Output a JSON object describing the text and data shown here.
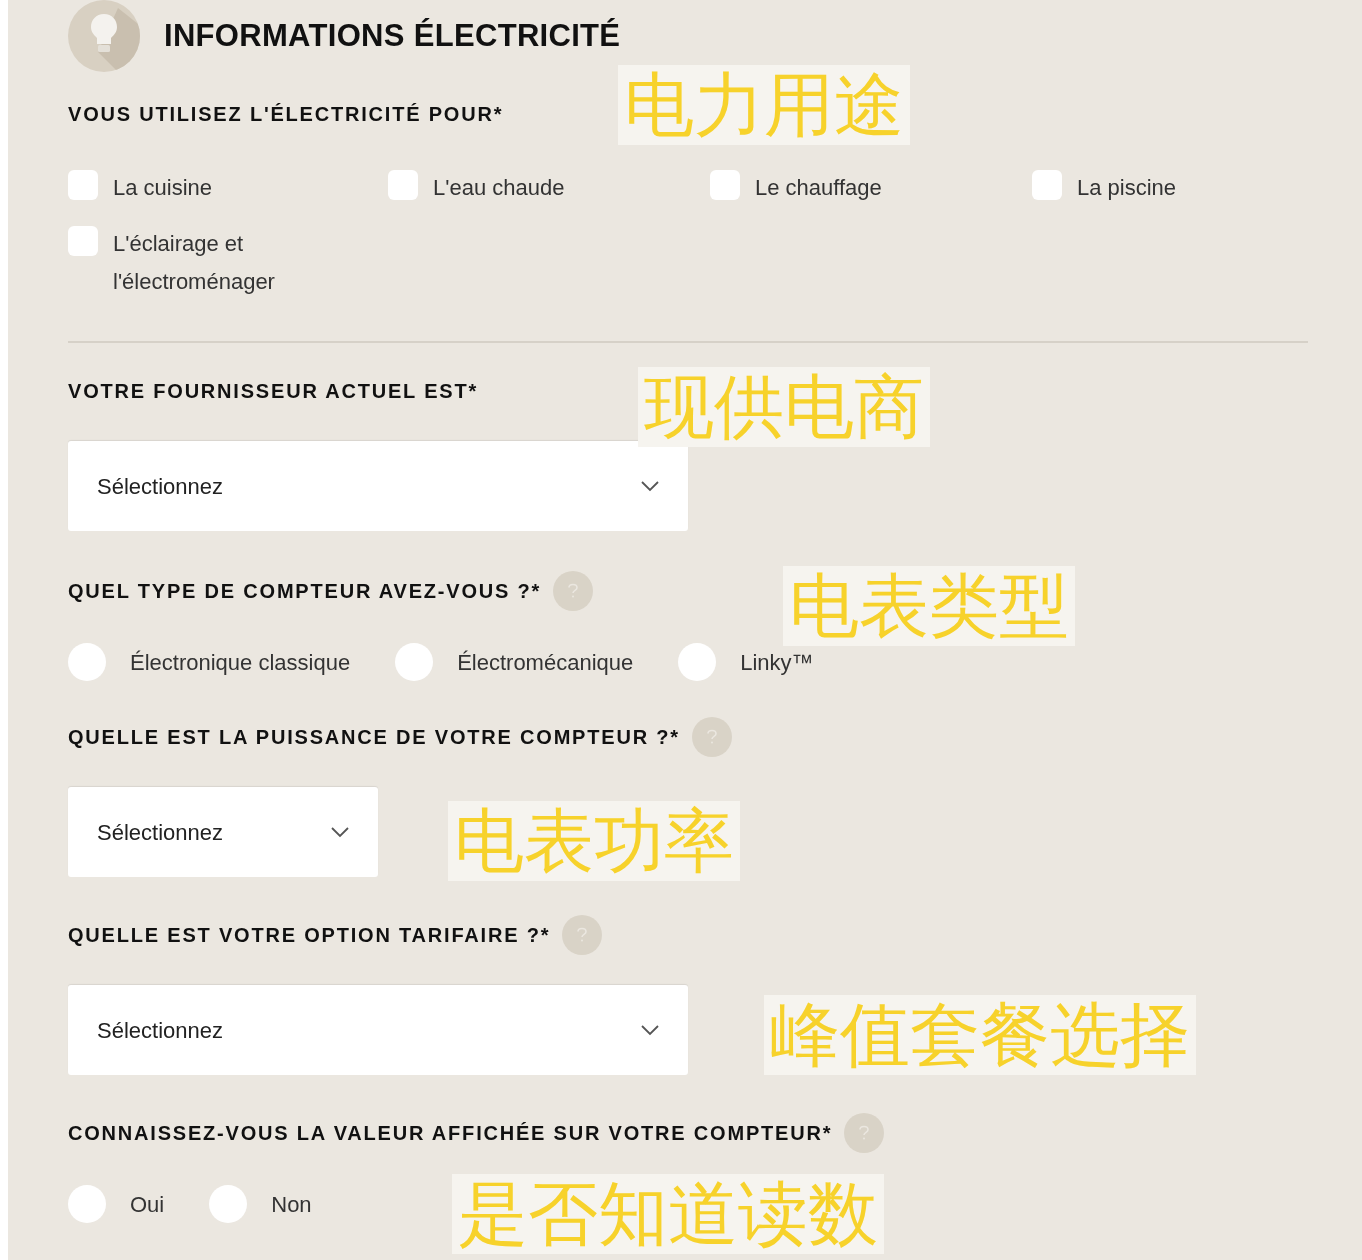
{
  "title": "INFORMATIONS ÉLECTRICITÉ",
  "sections": [
    {
      "kind": "checkboxes",
      "label": "VOUS UTILISEZ L'ÉLECTRICITÉ POUR*",
      "help": false,
      "options": [
        {
          "label": "La cuisine",
          "checked": false
        },
        {
          "label": "L'eau chaude",
          "checked": false
        },
        {
          "label": "Le chauffage",
          "checked": false
        },
        {
          "label": "La piscine",
          "checked": false
        },
        {
          "label": "L'éclairage et l'électroménager",
          "checked": false
        }
      ]
    },
    {
      "kind": "select",
      "label": "VOTRE FOURNISSEUR ACTUEL EST*",
      "help": false,
      "value": "Sélectionnez",
      "wide": true
    },
    {
      "kind": "radios",
      "label": "QUEL TYPE DE COMPTEUR AVEZ-VOUS ?*",
      "help": true,
      "options": [
        {
          "label": "Électronique classique",
          "selected": false
        },
        {
          "label": "Électromécanique",
          "selected": false
        },
        {
          "label": "Linky™",
          "selected": false
        }
      ]
    },
    {
      "kind": "select",
      "label": "QUELLE EST LA PUISSANCE DE VOTRE COMPTEUR ?*",
      "help": true,
      "value": "Sélectionnez",
      "wide": false
    },
    {
      "kind": "select",
      "label": "QUELLE EST VOTRE OPTION TARIFAIRE ?*",
      "help": true,
      "value": "Sélectionnez",
      "wide": true
    },
    {
      "kind": "radios",
      "label": "CONNAISSEZ-VOUS LA VALEUR AFFICHÉE SUR VOTRE COMPTEUR*",
      "help": true,
      "options": [
        {
          "label": "Oui",
          "selected": false
        },
        {
          "label": "Non",
          "selected": false
        }
      ]
    }
  ],
  "annotations": [
    "电力用途",
    "现供电商",
    "电表类型",
    "电表功率",
    "峰值套餐选择",
    "是否知道读数"
  ]
}
